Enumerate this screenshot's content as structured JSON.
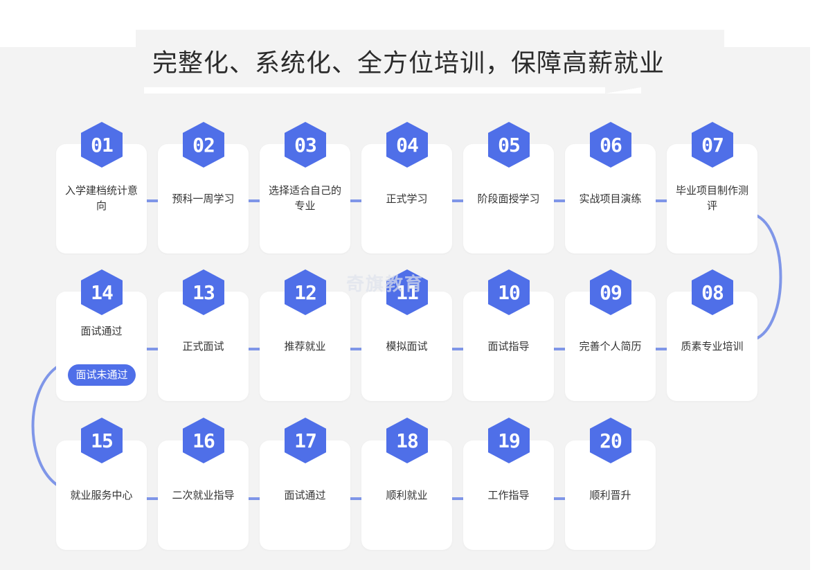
{
  "title": "完整化、系统化、全方位培训，保障高薪就业",
  "watermark": "奇旗教育",
  "accent_color": "#4f6fe8",
  "connector_color": "#7f96e8",
  "steps": [
    {
      "num": "01",
      "label": "入学建档统计意向"
    },
    {
      "num": "02",
      "label": "预科一周学习"
    },
    {
      "num": "03",
      "label": "选择适合自己的专业"
    },
    {
      "num": "04",
      "label": "正式学习"
    },
    {
      "num": "05",
      "label": "阶段面授学习"
    },
    {
      "num": "06",
      "label": "实战项目演练"
    },
    {
      "num": "07",
      "label": "毕业项目制作测评"
    },
    {
      "num": "08",
      "label": "质素专业培训"
    },
    {
      "num": "09",
      "label": "完善个人简历"
    },
    {
      "num": "10",
      "label": "面试指导"
    },
    {
      "num": "11",
      "label": "模拟面试"
    },
    {
      "num": "12",
      "label": "推荐就业"
    },
    {
      "num": "13",
      "label": "正式面试"
    },
    {
      "num": "14",
      "label": "面试通过",
      "badge": "面试未通过"
    },
    {
      "num": "15",
      "label": "就业服务中心"
    },
    {
      "num": "16",
      "label": "二次就业指导"
    },
    {
      "num": "17",
      "label": "面试通过"
    },
    {
      "num": "18",
      "label": "顺利就业"
    },
    {
      "num": "19",
      "label": "工作指导"
    },
    {
      "num": "20",
      "label": "顺利晋升"
    }
  ]
}
